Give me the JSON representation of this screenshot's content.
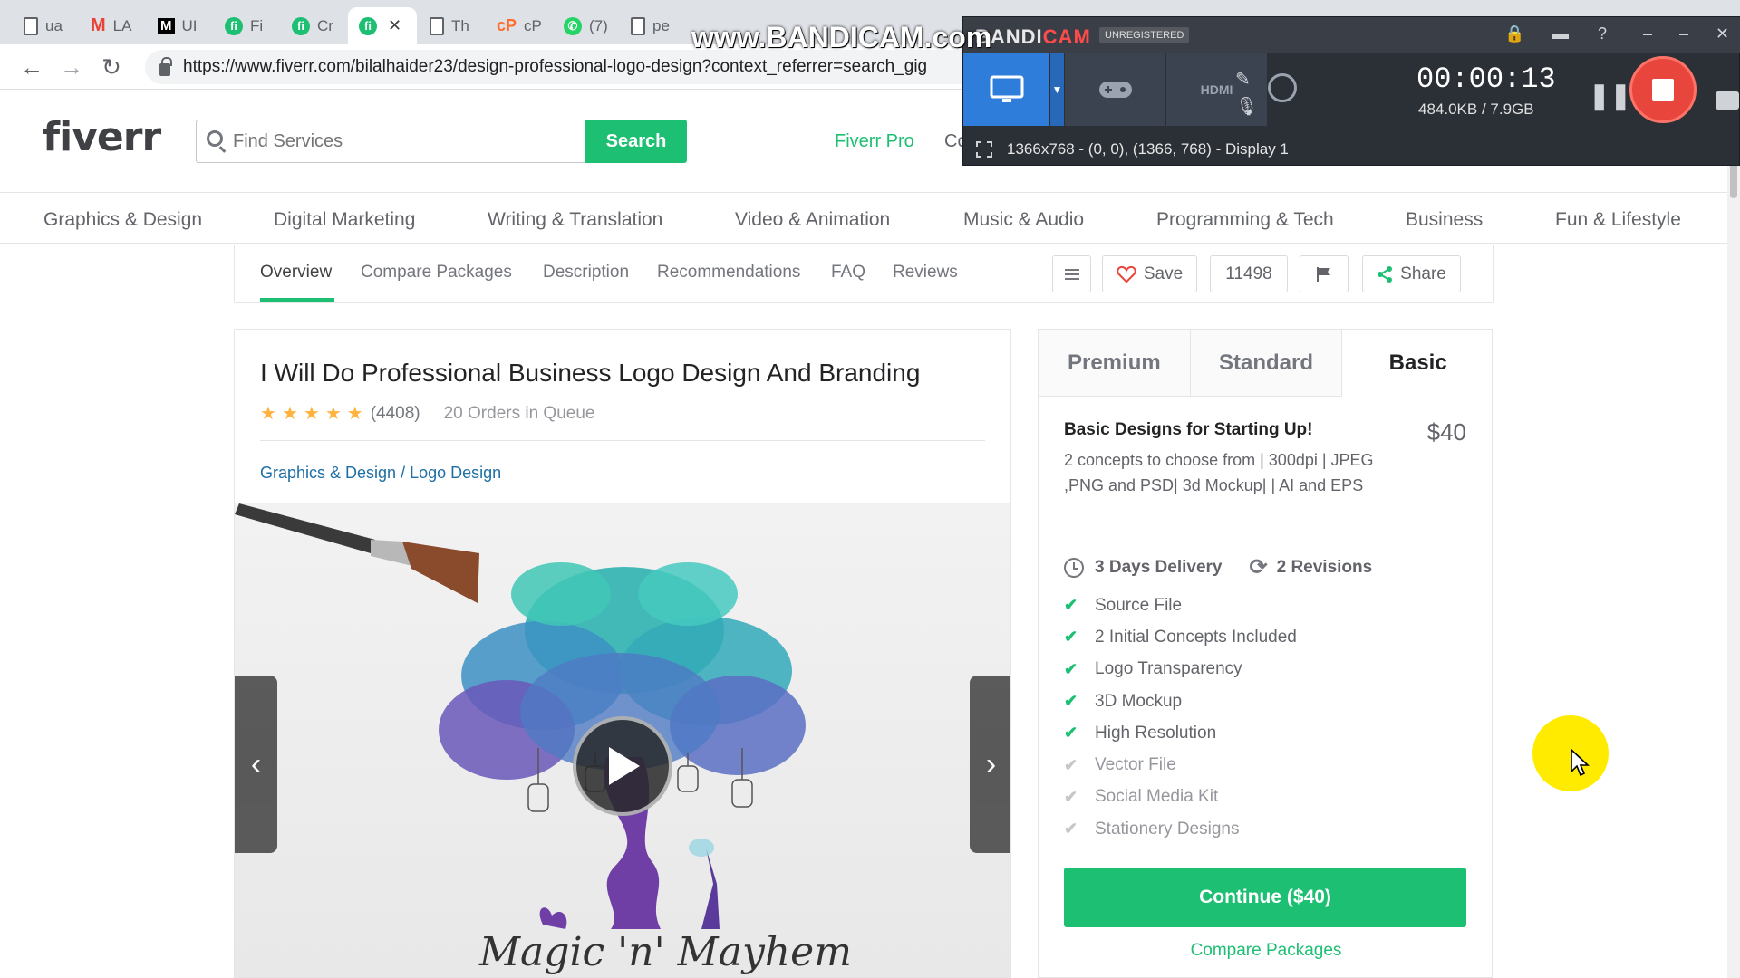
{
  "browser": {
    "tabs": [
      {
        "icon": "doc-icon",
        "text": "ua"
      },
      {
        "icon": "gmail-icon",
        "text": "LA"
      },
      {
        "icon": "medium-icon",
        "text": "UI"
      },
      {
        "icon": "fiverr-icon",
        "text": "Fi"
      },
      {
        "icon": "fiverr-icon",
        "text": "Cr"
      },
      {
        "icon": "fiverr-icon",
        "text": ""
      },
      {
        "icon": "doc-icon",
        "text": "Th"
      },
      {
        "icon": "cpanel-icon",
        "text": "cP"
      },
      {
        "icon": "whatsapp-icon",
        "text": "(7)"
      },
      {
        "icon": "doc-icon",
        "text": "pe"
      }
    ],
    "url": "https://www.fiverr.com/bilalhaider23/design-professional-logo-design?context_referrer=search_gig"
  },
  "header": {
    "logo": "fiverr",
    "search_placeholder": "Find Services",
    "search_button": "Search",
    "fiverr_pro": "Fiverr Pro",
    "truncated_link": "Co"
  },
  "categories": [
    "Graphics & Design",
    "Digital Marketing",
    "Writing & Translation",
    "Video & Animation",
    "Music & Audio",
    "Programming & Tech",
    "Business",
    "Fun & Lifestyle"
  ],
  "subnav": {
    "items": [
      "Overview",
      "Compare Packages",
      "Description",
      "Recommendations",
      "FAQ",
      "Reviews"
    ],
    "save_label": "Save",
    "save_count": "11498",
    "share_label": "Share"
  },
  "gig": {
    "title": "I Will Do Professional Business Logo Design And Branding",
    "rating_stars": 5,
    "rating_count": "(4408)",
    "orders_in_queue": "20 Orders in Queue",
    "breadcrumb": "Graphics & Design / Logo Design",
    "media_brand_text": "Magic 'n' Mayhem"
  },
  "packages": {
    "tabs": [
      "Premium",
      "Standard",
      "Basic"
    ],
    "selected": "Basic",
    "name": "Basic Designs for Starting Up!",
    "price": "$40",
    "description": "2 concepts to choose from | 300dpi | JPEG ,PNG and PSD| 3d Mockup| | AI and EPS",
    "delivery": "3 Days Delivery",
    "revisions": "2 Revisions",
    "features": [
      {
        "label": "Source File",
        "included": true
      },
      {
        "label": "2 Initial Concepts Included",
        "included": true
      },
      {
        "label": "Logo Transparency",
        "included": true
      },
      {
        "label": "3D Mockup",
        "included": true
      },
      {
        "label": "High Resolution",
        "included": true
      },
      {
        "label": "Vector File",
        "included": false
      },
      {
        "label": "Social Media Kit",
        "included": false
      },
      {
        "label": "Stationery Designs",
        "included": false
      }
    ],
    "continue_label": "Continue ($40)",
    "compare_label": "Compare Packages"
  },
  "bandicam": {
    "watermark": "www.BANDICAM.com",
    "logo_a": "BANDI",
    "logo_b": "CAM",
    "unregistered": "UNREGISTERED",
    "timer": "00:00:13",
    "size": "484.0KB / 7.9GB",
    "hdmi_label": "HDMI",
    "status": "1366x768 - (0, 0), (1366, 768) - Display 1"
  },
  "colors": {
    "fiverr_green": "#1dbf73",
    "link_blue": "#1d6fa5",
    "star": "#ffb33e",
    "bandicam_blue": "#2f7ddb",
    "record_red": "#e8453c",
    "cursor_highlight": "#ffeb00"
  }
}
